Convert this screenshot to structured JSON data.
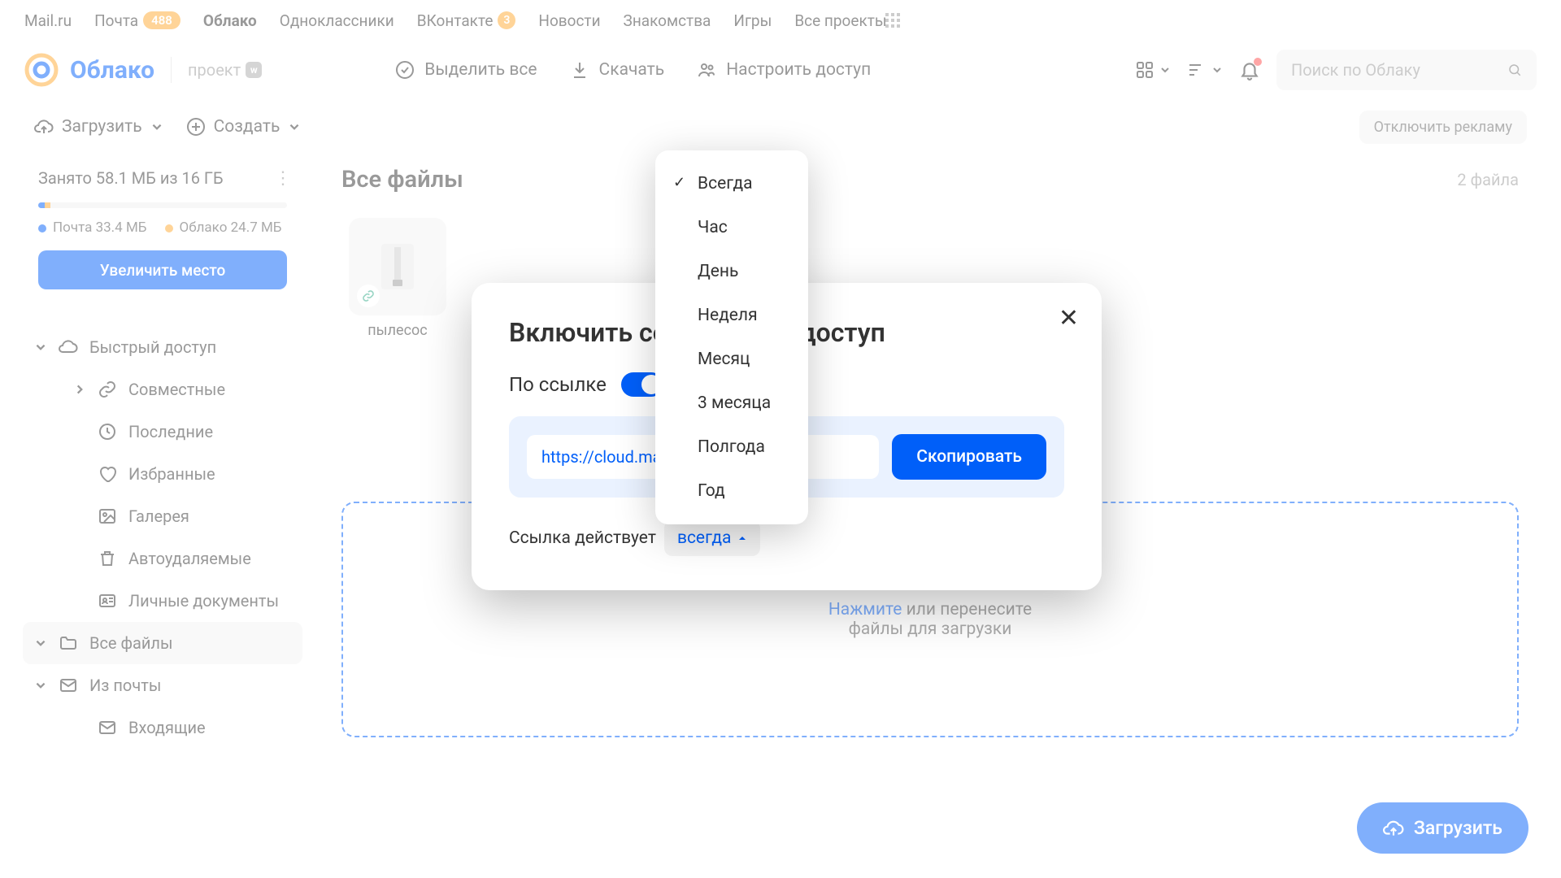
{
  "portal": {
    "links": [
      "Mail.ru",
      "Почта",
      "Облако",
      "Одноклассники",
      "ВКонтакте",
      "Новости",
      "Знакомства",
      "Игры",
      "Все проекты"
    ],
    "mail_badge": "488",
    "vk_badge": "3"
  },
  "header": {
    "brand": "Облако",
    "project": "проект",
    "select_all": "Выделить все",
    "download": "Скачать",
    "share": "Настроить доступ",
    "search_placeholder": "Поиск по Облаку"
  },
  "subtoolbar": {
    "upload": "Загрузить",
    "create": "Создать",
    "disable_ads": "Отключить рекламу"
  },
  "sidebar": {
    "storage_title": "Занято 58.1 МБ из 16 ГБ",
    "mail_usage": "Почта 33.4 МБ",
    "cloud_usage": "Облако 24.7 МБ",
    "upgrade": "Увеличить место",
    "quick_access": "Быстрый доступ",
    "items": [
      "Совместные",
      "Последние",
      "Избранные",
      "Галерея",
      "Автоудаляемые",
      "Личные документы"
    ],
    "all_files": "Все файлы",
    "from_mail": "Из почты",
    "inbox": "Входящие"
  },
  "main": {
    "title": "Все файлы",
    "count": "2 файла",
    "file1": "пылесос",
    "drop_link": "Нажмите",
    "drop_text": " или перенесите",
    "drop_text2": "файлы для загрузки",
    "fab": "Загрузить"
  },
  "modal": {
    "title": "Включить совместный доступ",
    "by_link": "По ссылке",
    "url": "https://cloud.mail",
    "copy": "Скопировать",
    "expiry_label": "Ссылка действует",
    "expiry_value": "всегда"
  },
  "dropdown": {
    "items": [
      "Всегда",
      "Час",
      "День",
      "Неделя",
      "Месяц",
      "3 месяца",
      "Полгода",
      "Год"
    ]
  },
  "colors": {
    "primary": "#005ff9",
    "accent": "#ffa930"
  }
}
